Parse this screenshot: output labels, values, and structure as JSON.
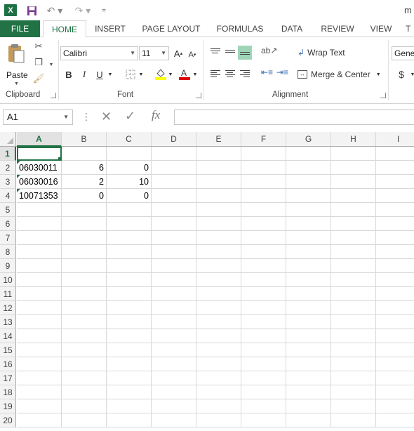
{
  "titlebar": {
    "app_logo": "X",
    "title_fragment": "m",
    "qa_undo": "↶ ▾",
    "qa_redo": "↷ ▾",
    "qa_customize": "="
  },
  "ribbon_tabs": [
    "FILE",
    "HOME",
    "INSERT",
    "PAGE LAYOUT",
    "FORMULAS",
    "DATA",
    "REVIEW",
    "VIEW",
    "T"
  ],
  "active_tab": "HOME",
  "clipboard": {
    "paste_label": "Paste",
    "group_label": "Clipboard"
  },
  "font": {
    "name": "Calibri",
    "size": "11",
    "grow": "A",
    "shrink": "A",
    "bold": "B",
    "italic": "I",
    "underline": "U",
    "group_label": "Font",
    "fill_color": "#ffff00",
    "font_color": "#e00000"
  },
  "alignment": {
    "wrap_text": "Wrap Text",
    "merge_center": "Merge & Center",
    "group_label": "Alignment"
  },
  "number": {
    "format": "Gene",
    "currency": "$"
  },
  "formula_bar": {
    "name_box": "A1",
    "fx": "fx",
    "formula": ""
  },
  "columns": [
    "A",
    "B",
    "C",
    "D",
    "E",
    "F",
    "G",
    "H",
    "I"
  ],
  "active_column": "A",
  "rows": [
    {
      "n": "1",
      "cells": [
        "",
        "",
        ""
      ]
    },
    {
      "n": "2",
      "cells": [
        "06030011",
        "6",
        "0"
      ]
    },
    {
      "n": "3",
      "cells": [
        "06030016",
        "2",
        "10"
      ]
    },
    {
      "n": "4",
      "cells": [
        "10071353",
        "0",
        "0"
      ]
    },
    {
      "n": "5",
      "cells": [
        "",
        "",
        ""
      ]
    },
    {
      "n": "6",
      "cells": [
        "",
        "",
        ""
      ]
    },
    {
      "n": "7",
      "cells": [
        "",
        "",
        ""
      ]
    },
    {
      "n": "8",
      "cells": [
        "",
        "",
        ""
      ]
    },
    {
      "n": "9",
      "cells": [
        "",
        "",
        ""
      ]
    },
    {
      "n": "10",
      "cells": [
        "",
        "",
        ""
      ]
    },
    {
      "n": "11",
      "cells": [
        "",
        "",
        ""
      ]
    },
    {
      "n": "12",
      "cells": [
        "",
        "",
        ""
      ]
    },
    {
      "n": "13",
      "cells": [
        "",
        "",
        ""
      ]
    },
    {
      "n": "14",
      "cells": [
        "",
        "",
        ""
      ]
    },
    {
      "n": "15",
      "cells": [
        "",
        "",
        ""
      ]
    },
    {
      "n": "16",
      "cells": [
        "",
        "",
        ""
      ]
    },
    {
      "n": "17",
      "cells": [
        "",
        "",
        ""
      ]
    },
    {
      "n": "18",
      "cells": [
        "",
        "",
        ""
      ]
    },
    {
      "n": "19",
      "cells": [
        "",
        "",
        ""
      ]
    },
    {
      "n": "20",
      "cells": [
        "",
        "",
        ""
      ]
    }
  ],
  "selected_cell": "A1",
  "accent_color": "#217346"
}
